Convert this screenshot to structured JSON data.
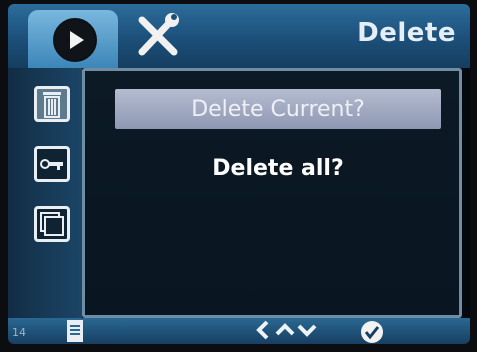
{
  "header": {
    "title": "Delete",
    "tabs": [
      {
        "icon": "play-icon",
        "active": true
      },
      {
        "icon": "tools-icon",
        "active": false
      }
    ]
  },
  "sidebar": {
    "items": [
      {
        "icon": "trash-icon",
        "active": true
      },
      {
        "icon": "key-icon",
        "active": false
      },
      {
        "icon": "copy-pages-icon",
        "active": false
      }
    ]
  },
  "menu": {
    "options": [
      {
        "label": "Delete Current?",
        "selected": true
      },
      {
        "label": "Delete all?",
        "selected": false
      }
    ]
  },
  "footer": {
    "page_number": "14",
    "nav_label": "<^v",
    "icons": [
      "document-icon",
      "nav-arrows-icon",
      "confirm-check-icon"
    ]
  },
  "colors": {
    "bar_blue": "#1c4f79",
    "highlight": "#a5adc4",
    "panel_border": "#6f8ea6"
  }
}
